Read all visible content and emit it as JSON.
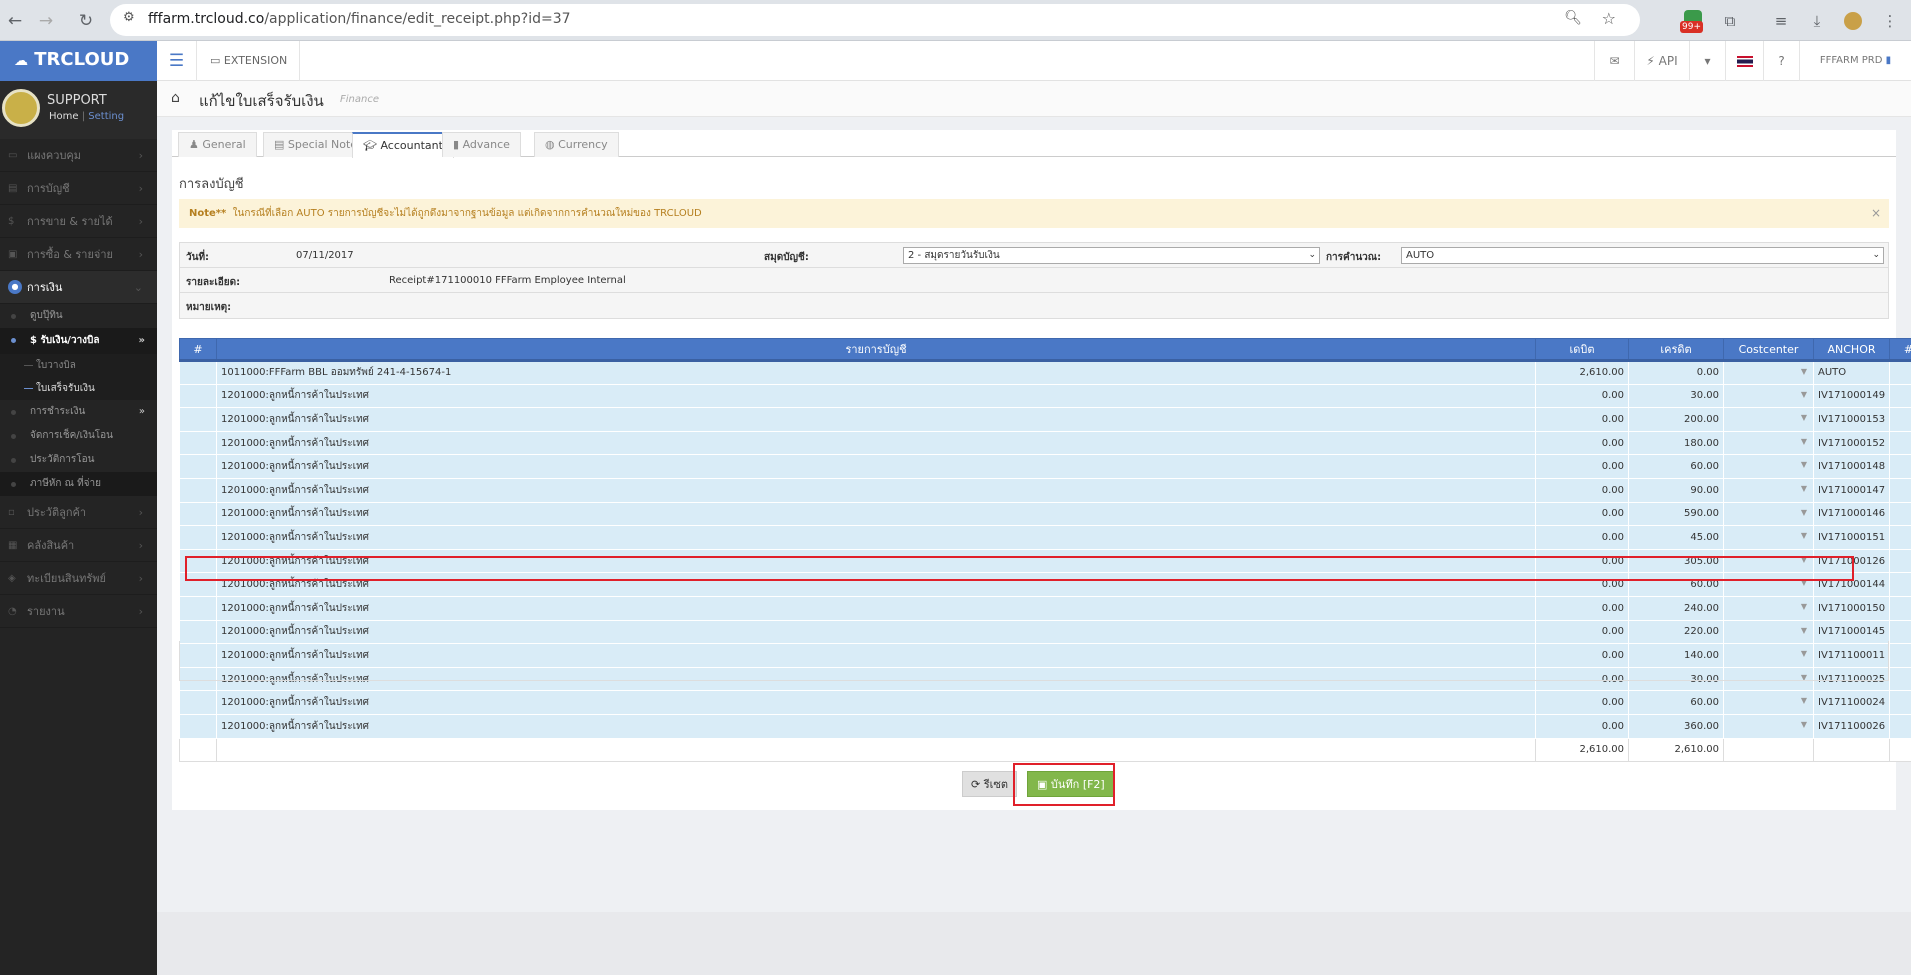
{
  "browser": {
    "url_domain": "fffarm.trcloud.co",
    "url_path": "/application/finance/edit_receipt.php?id=37",
    "badge": "99+"
  },
  "sidebar": {
    "brand": "TRCLOUD",
    "profile_name": "SUPPORT",
    "link_home": "Home",
    "link_sep": "|",
    "link_setting": "Setting",
    "menu": [
      {
        "label": "แผงควบคุม"
      },
      {
        "label": "การบัญชี"
      },
      {
        "label": "การขาย & รายได้"
      },
      {
        "label": "การซื้อ & รายจ่าย"
      },
      {
        "label": "การเงิน"
      }
    ],
    "finance_sub": [
      {
        "label": "ดูบปุ๊ทิน"
      },
      {
        "label": "$ รับเงิน/วางบิล"
      }
    ],
    "finance_sub2": [
      {
        "label": "ใบวางบิล"
      },
      {
        "label": "ใบเสร็จรับเงิน"
      }
    ],
    "finance_sub3": [
      {
        "label": "การชำระเงิน"
      },
      {
        "label": "จัดการเช็ค/เงินโอน"
      },
      {
        "label": "ประวัติการโอน"
      },
      {
        "label": "ภาษีหัก ณ ที่จ่าย"
      }
    ],
    "menu_bottom": [
      {
        "label": "ประวัติลูกค้า"
      },
      {
        "label": "คลังสินค้า"
      },
      {
        "label": "ทะเบียนสินทรัพย์"
      },
      {
        "label": "รายงาน"
      }
    ]
  },
  "topbar": {
    "extension": "EXTENSION",
    "api": "API",
    "company": "FFFARM PRD"
  },
  "page": {
    "title": "แก้ไขใบเสร็จรับเงิน",
    "module": "Finance",
    "tabs": [
      "General",
      "Special Note",
      "Accountant",
      "Advance",
      "Currency"
    ],
    "section_title": "การลงบัญชี",
    "note_label": "Note**",
    "note_text": "ในกรณีที่เลือก AUTO รายการบัญชีจะไม่ได้ถูกดึงมาจากฐานข้อมูล แต่เกิดจากการคำนวณใหม่ของ TRCLOUD",
    "close": "×"
  },
  "info": {
    "date_label": "วันที่:",
    "date_value": "07/11/2017",
    "book_label": "สมุดบัญชี:",
    "book_value": "2 - สมุดรายวันรับเงิน",
    "calc_label": "การคำนวณ:",
    "calc_value": "AUTO",
    "detail_label": "รายละเอียด:",
    "detail_value": "Receipt#171100010  FFFarm Employee Internal",
    "remark_label": "หมายเหตุ:"
  },
  "table": {
    "headers": [
      "#",
      "รายการบัญชี",
      "เดบิต",
      "เครดิต",
      "Costcenter",
      "ANCHOR",
      "#"
    ],
    "rows": [
      {
        "account": "1011000:FFFarm BBL ออมทรัพย์ 241-4-15674-1",
        "debit": "2,610.00",
        "credit": "0.00",
        "anchor": "AUTO"
      },
      {
        "account": "1201000:ลูกหนี้การค้าในประเทศ",
        "debit": "0.00",
        "credit": "30.00",
        "anchor": "IV171000149"
      },
      {
        "account": "1201000:ลูกหนี้การค้าในประเทศ",
        "debit": "0.00",
        "credit": "200.00",
        "anchor": "IV171000153"
      },
      {
        "account": "1201000:ลูกหนี้การค้าในประเทศ",
        "debit": "0.00",
        "credit": "180.00",
        "anchor": "IV171000152"
      },
      {
        "account": "1201000:ลูกหนี้การค้าในประเทศ",
        "debit": "0.00",
        "credit": "60.00",
        "anchor": "IV171000148"
      },
      {
        "account": "1201000:ลูกหนี้การค้าในประเทศ",
        "debit": "0.00",
        "credit": "90.00",
        "anchor": "IV171000147"
      },
      {
        "account": "1201000:ลูกหนี้การค้าในประเทศ",
        "debit": "0.00",
        "credit": "590.00",
        "anchor": "IV171000146"
      },
      {
        "account": "1201000:ลูกหนี้การค้าในประเทศ",
        "debit": "0.00",
        "credit": "45.00",
        "anchor": "IV171000151"
      },
      {
        "account": "1201000:ลูกหนี้การค้าในประเทศ",
        "debit": "0.00",
        "credit": "305.00",
        "anchor": "IV171000126"
      },
      {
        "account": "1201000:ลูกหนี้การค้าในประเทศ",
        "debit": "0.00",
        "credit": "60.00",
        "anchor": "IV171000144"
      },
      {
        "account": "1201000:ลูกหนี้การค้าในประเทศ",
        "debit": "0.00",
        "credit": "240.00",
        "anchor": "IV171000150"
      },
      {
        "account": "1201000:ลูกหนี้การค้าในประเทศ",
        "debit": "0.00",
        "credit": "220.00",
        "anchor": "IV171000145"
      },
      {
        "account": "1201000:ลูกหนี้การค้าในประเทศ",
        "debit": "0.00",
        "credit": "140.00",
        "anchor": "IV171100011"
      },
      {
        "account": "1201000:ลูกหนี้การค้าในประเทศ",
        "debit": "0.00",
        "credit": "30.00",
        "anchor": "IV171100025"
      },
      {
        "account": "1201000:ลูกหนี้การค้าในประเทศ",
        "debit": "0.00",
        "credit": "60.00",
        "anchor": "IV171100024"
      },
      {
        "account": "1201000:ลูกหนี้การค้าในประเทศ",
        "debit": "0.00",
        "credit": "360.00",
        "anchor": "IV171100026"
      }
    ],
    "total_debit": "2,610.00",
    "total_credit": "2,610.00"
  },
  "actions": {
    "reset": "รีเซต",
    "save": "บันทึก [F2]"
  },
  "colors": {
    "brand": "#4a78c6",
    "save": "#82b74b",
    "highlight": "#e0202a"
  }
}
